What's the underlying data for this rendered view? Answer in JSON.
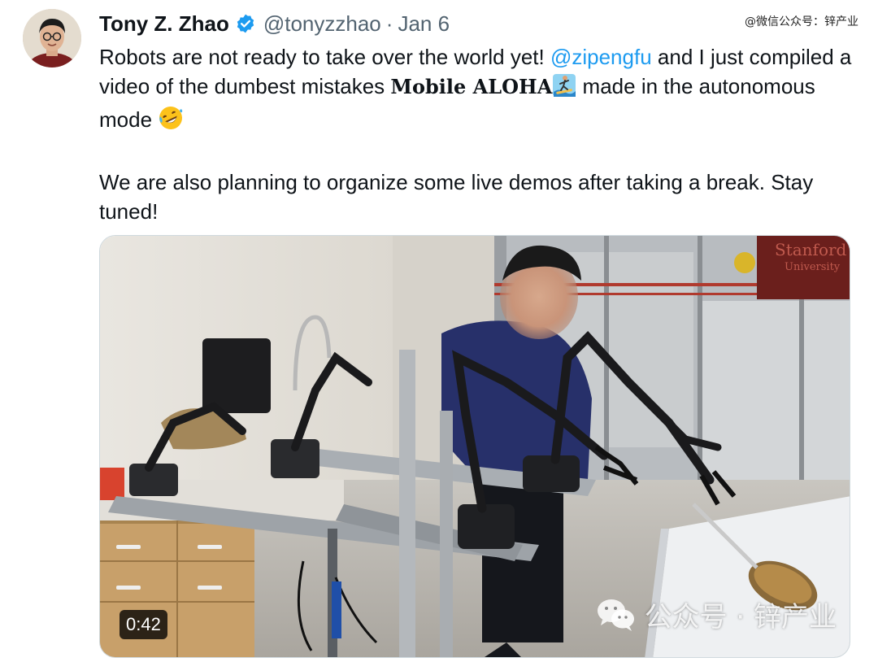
{
  "watermark_top": "@微信公众号：锌产业",
  "author": {
    "name": "Tony Z. Zhao",
    "handle": "@tonyzzhao",
    "separator": "·",
    "date": "Jan 6"
  },
  "tweet": {
    "line_a": "Robots are not ready to take over the world yet! ",
    "mention": "@zipengfu",
    "line_b": " and I just compiled a video of the dumbest mistakes ",
    "brand": "Mobile ALOHA",
    "line_c": " made in the autonomous mode ",
    "para2": "We are also planning to organize some live demos after taking a break. Stay tuned!"
  },
  "media": {
    "duration": "0:42",
    "watermark": "公众号 · 锌产业",
    "sign_text_1": "Stanford",
    "sign_text_2": "University"
  },
  "colors": {
    "mention": "#1d9bf0",
    "verified": "#1d9bf0",
    "muted": "#536471"
  }
}
